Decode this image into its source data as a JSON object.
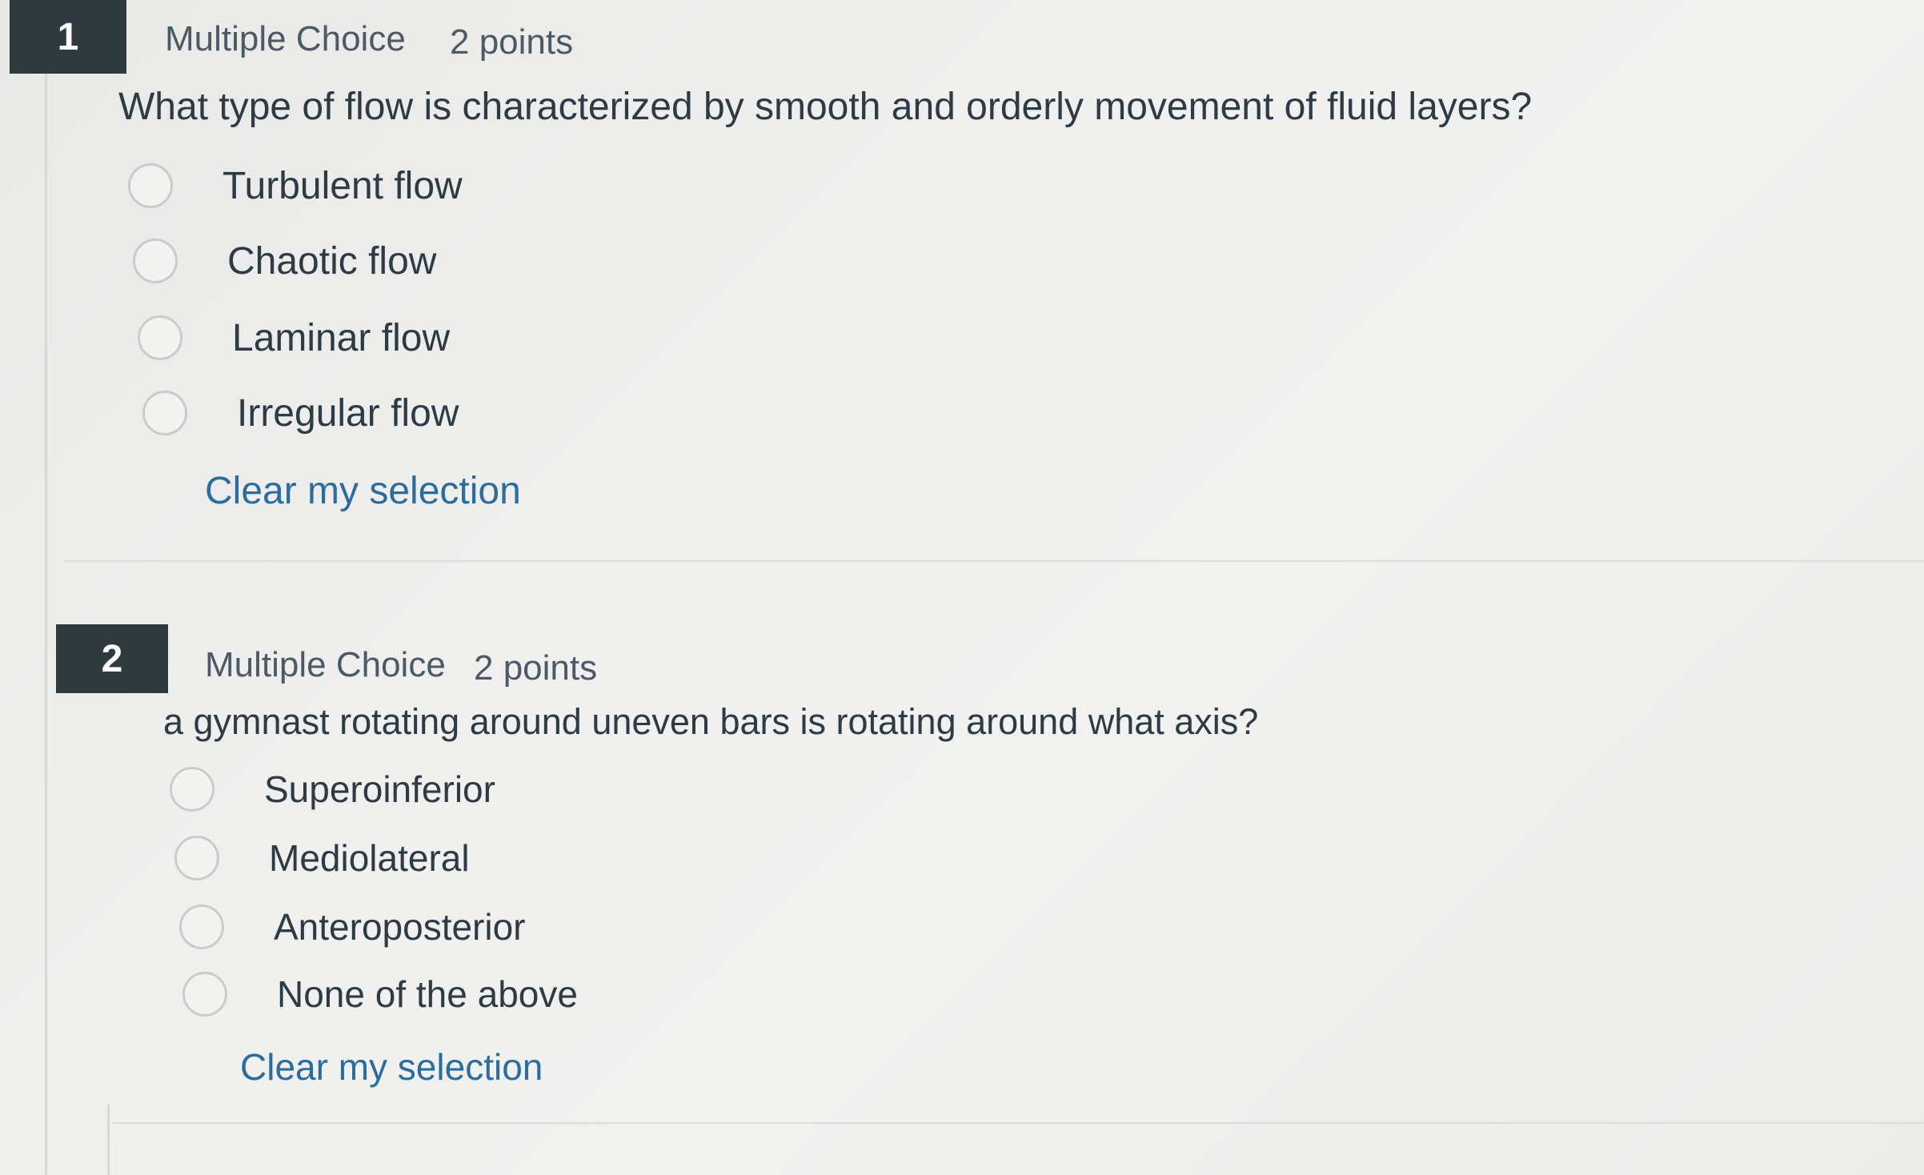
{
  "questions": [
    {
      "number": "1",
      "type": "Multiple Choice",
      "points": "2 points",
      "text": "What type of flow is characterized by smooth and orderly movement of fluid layers?",
      "options": [
        "Turbulent flow",
        "Chaotic flow",
        "Laminar flow",
        "Irregular flow"
      ],
      "clear_label": "Clear my selection"
    },
    {
      "number": "2",
      "type": "Multiple Choice",
      "points": "2 points",
      "text": "a gymnast rotating around uneven bars is rotating around what axis?",
      "options": [
        "Superoinferior",
        "Mediolateral",
        "Anteroposterior",
        "None of the above"
      ],
      "clear_label": "Clear my selection"
    }
  ]
}
